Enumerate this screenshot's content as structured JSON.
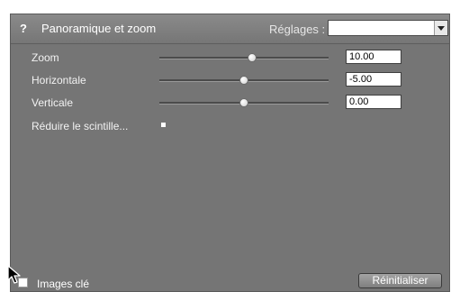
{
  "panel": {
    "help_symbol": "?",
    "title": "Panoramique et zoom",
    "preset_label": "Réglages :",
    "preset_value": ""
  },
  "params": [
    {
      "label": "Zoom",
      "value": "10.00",
      "slider_fraction": 0.55
    },
    {
      "label": "Horizontale",
      "value": "-5.00",
      "slider_fraction": 0.5
    },
    {
      "label": "Verticale",
      "value": "0.00",
      "slider_fraction": 0.5
    }
  ],
  "flicker": {
    "label": "Réduire le scintille...",
    "checked": false
  },
  "footer": {
    "keyframes_label": "Images clé",
    "keyframes_checked": false,
    "reset_label": "Réinitialiser"
  },
  "colors": {
    "panel_bg": "#757575",
    "header_bg": "#808080",
    "text": "#ffffff",
    "field_bg": "#ffffff"
  },
  "icons": {
    "help": "help-icon",
    "cursor": "arrow-cursor-icon",
    "dropdown": "chevron-down-icon"
  }
}
